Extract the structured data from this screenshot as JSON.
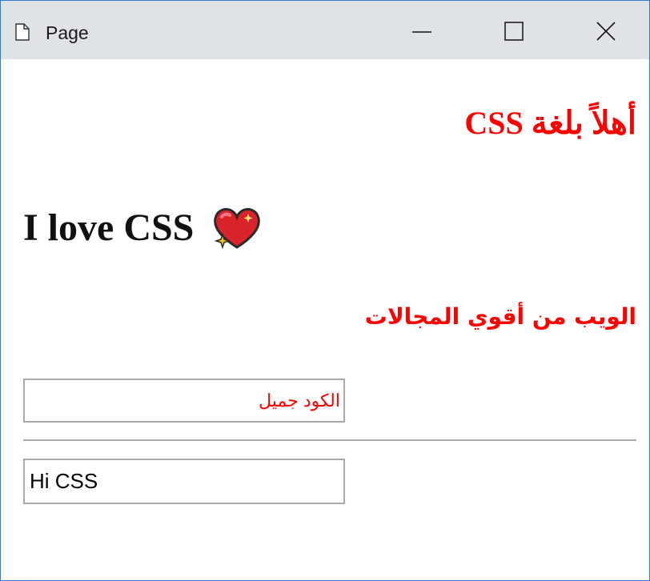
{
  "window": {
    "title": "Page",
    "accent_color": "#2b7bd4",
    "titlebar_color": "#dfe3e8",
    "controls": {
      "minimize_icon": "minimize-icon",
      "maximize_icon": "maximize-icon",
      "close_icon": "close-icon"
    },
    "page_icon": "page-icon"
  },
  "content": {
    "heading_rtl_1": "أهلاً بلغة CSS",
    "heading_ltr": "I love CSS",
    "heart_icon": "sparkling-heart-icon",
    "heading_rtl_2": "الويب من أقوي المجالات",
    "input_rtl": {
      "value": "",
      "placeholder": "الكود جميل"
    },
    "input_ltr": {
      "value": "Hi CSS"
    },
    "colors": {
      "red_text": "#ff0000",
      "dark_text": "#111111",
      "input_border": "#a9a9a9"
    }
  }
}
